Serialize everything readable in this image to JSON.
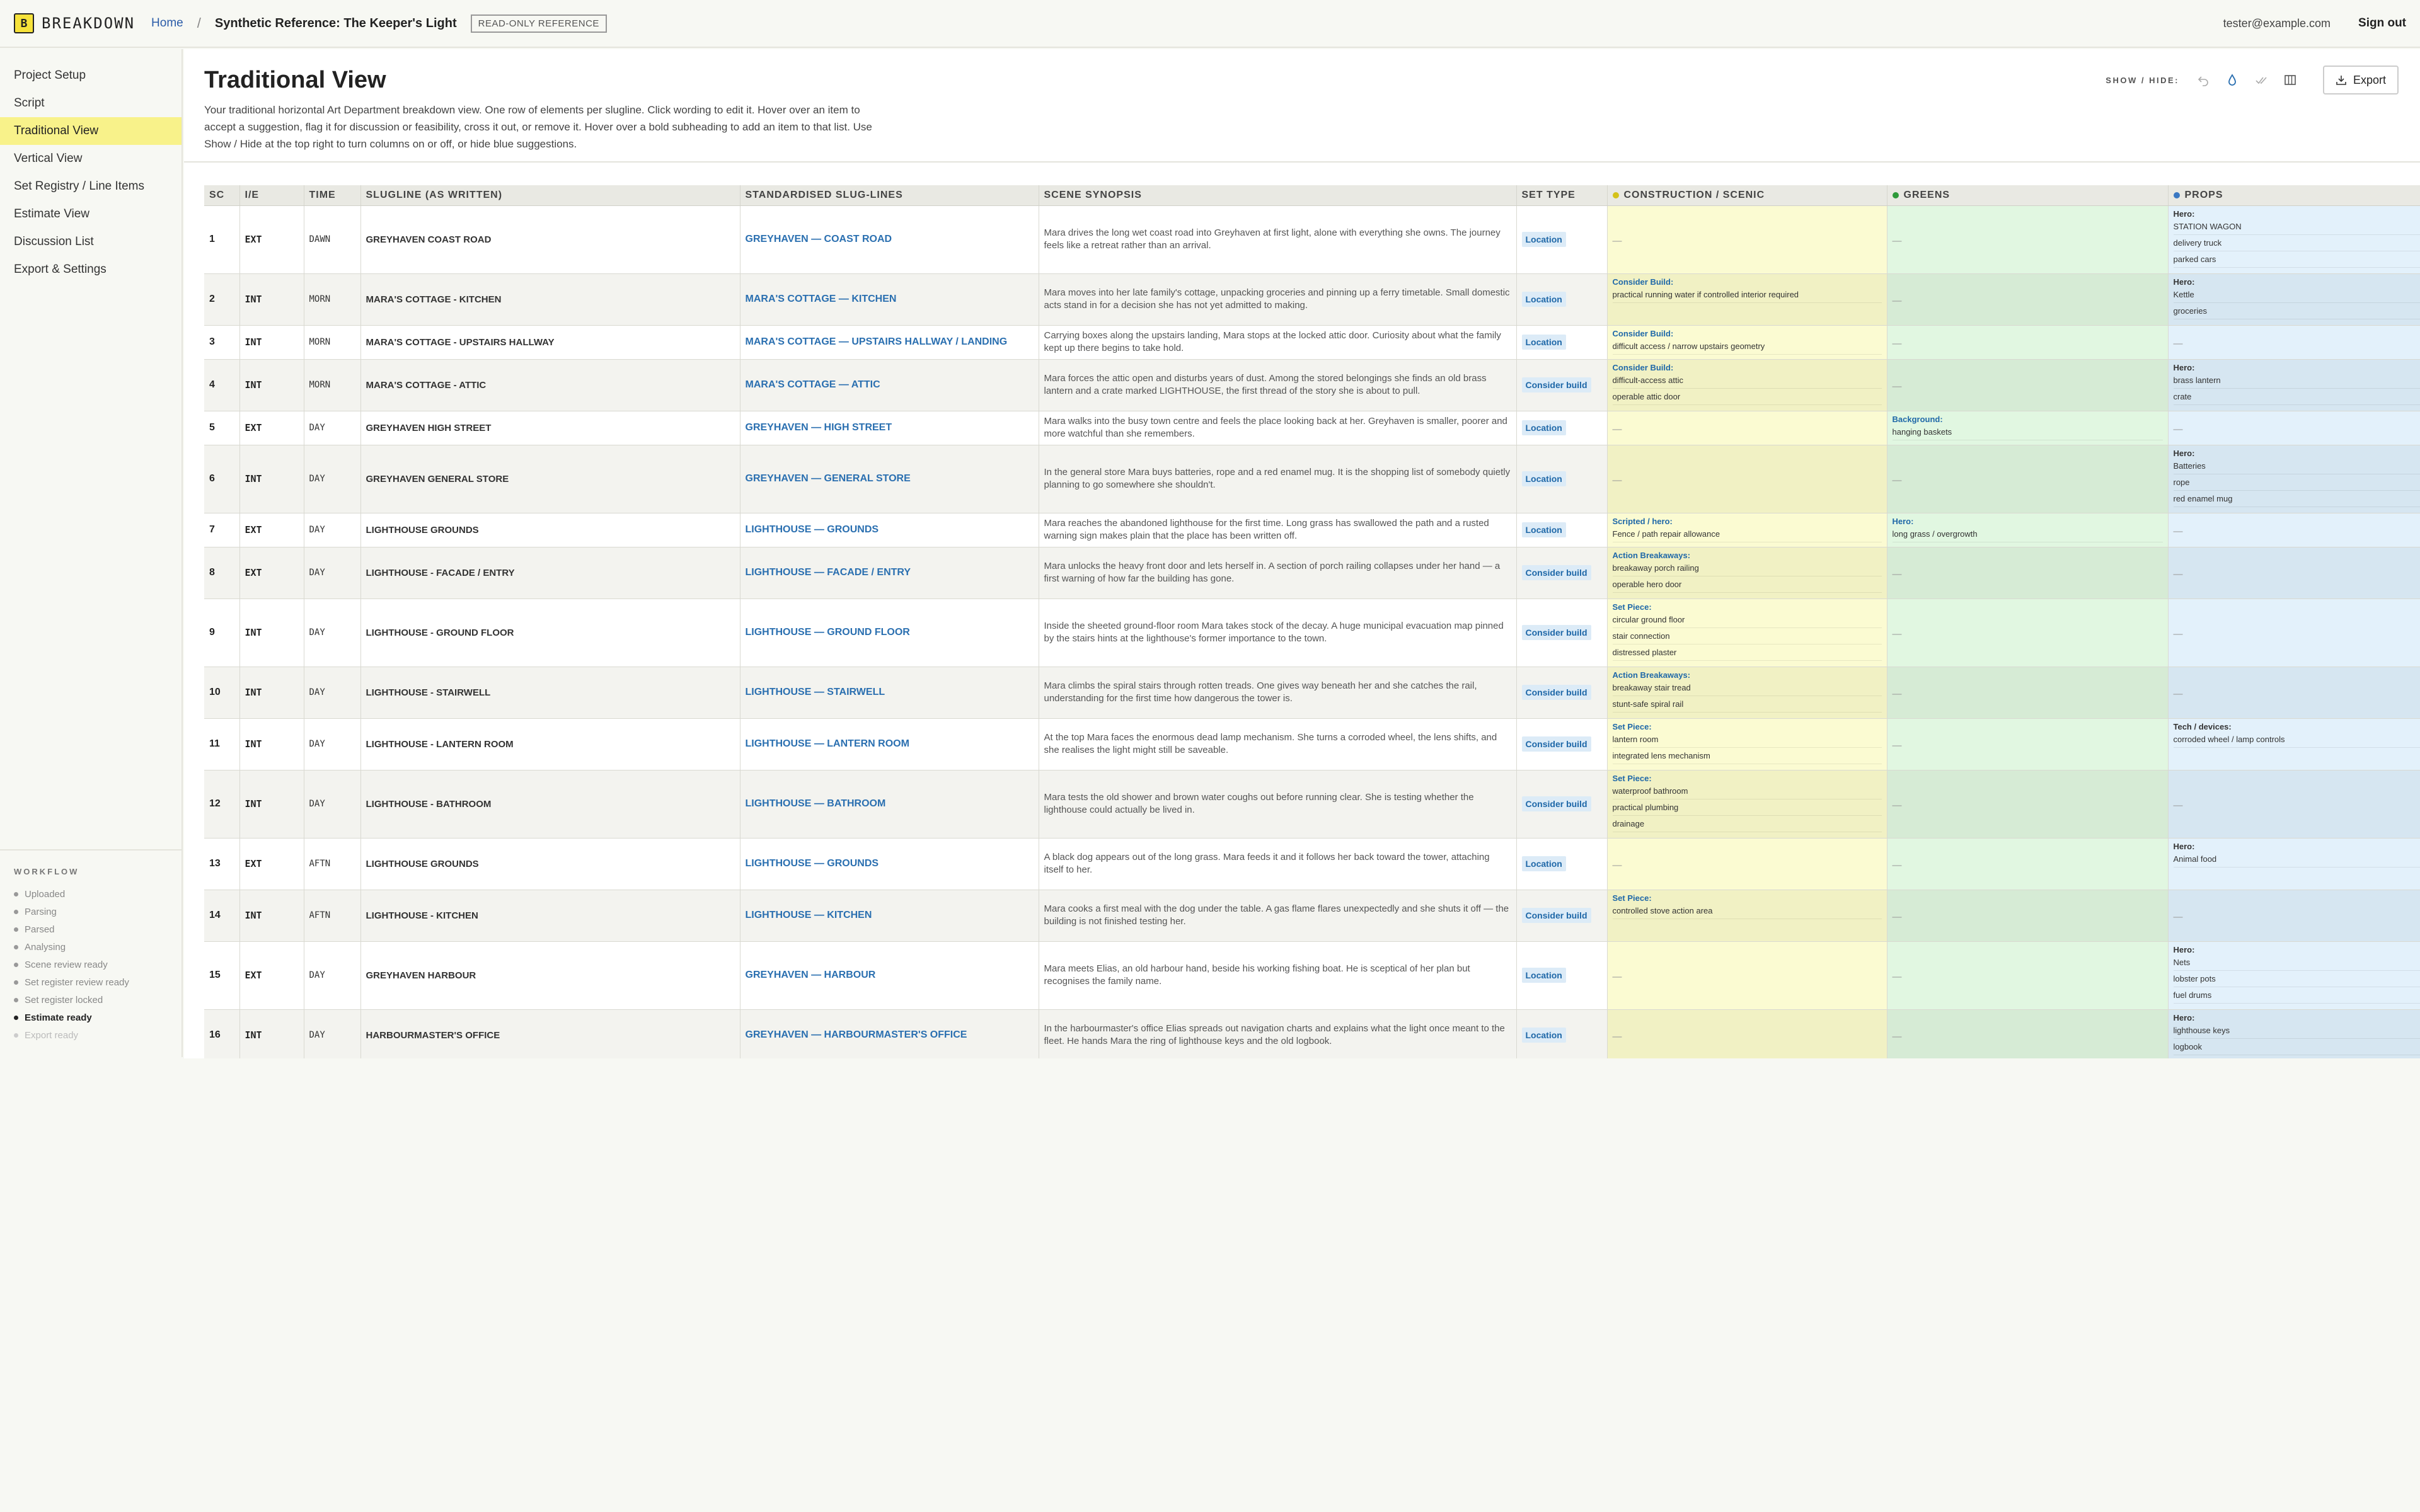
{
  "app": {
    "name": "BREAKDOWN",
    "logo_letter": "B"
  },
  "breadcrumb": {
    "home": "Home",
    "separator": "/",
    "title": "Synthetic Reference: The Keeper's Light",
    "badge": "READ-ONLY REFERENCE"
  },
  "user": {
    "email": "tester@example.com",
    "signout": "Sign out"
  },
  "nav": [
    {
      "label": "Project Setup",
      "active": false
    },
    {
      "label": "Script",
      "active": false
    },
    {
      "label": "Traditional View",
      "active": true
    },
    {
      "label": "Vertical View",
      "active": false
    },
    {
      "label": "Set Registry / Line Items",
      "active": false
    },
    {
      "label": "Estimate View",
      "active": false
    },
    {
      "label": "Discussion List",
      "active": false
    },
    {
      "label": "Export & Settings",
      "active": false
    }
  ],
  "workflow": {
    "title": "WORKFLOW",
    "steps": [
      {
        "label": "Uploaded",
        "state": "done"
      },
      {
        "label": "Parsing",
        "state": "done"
      },
      {
        "label": "Parsed",
        "state": "done"
      },
      {
        "label": "Analysing",
        "state": "done"
      },
      {
        "label": "Scene review ready",
        "state": "done"
      },
      {
        "label": "Set register review ready",
        "state": "done"
      },
      {
        "label": "Set register locked",
        "state": "done"
      },
      {
        "label": "Estimate ready",
        "state": "current"
      },
      {
        "label": "Export ready",
        "state": "future"
      }
    ]
  },
  "page": {
    "title": "Traditional View",
    "description": "Your traditional horizontal Art Department breakdown view. One row of elements per slugline. Click wording to edit it. Hover over an item to accept a suggestion, flag it for discussion or feasibility, cross it out, or remove it. Hover over a bold subheading to add an item to that list. Use Show / Hide at the top right to turn columns on or off, or hide blue suggestions."
  },
  "toolbar": {
    "show_hide": "SHOW / HIDE:",
    "export": "Export"
  },
  "colors": {
    "construction": "#d4c21a",
    "greens": "#2e9a3a",
    "props": "#3a78c2",
    "accent": "#f8f28a",
    "link": "#2a6fb0"
  },
  "columns": [
    "SC",
    "I/E",
    "TIME",
    "SLUGLINE (AS WRITTEN)",
    "STANDARDISED SLUG-LINES",
    "SCENE SYNOPSIS",
    "SET TYPE",
    "CONSTRUCTION / SCENIC",
    "GREENS",
    "PROPS"
  ],
  "empty_mark": "—",
  "rows": [
    {
      "sc": "1",
      "ie": "EXT",
      "time": "DAWN",
      "slug": "GREYHAVEN COAST ROAD",
      "std": "GREYHAVEN — COAST ROAD",
      "syn": "Mara drives the long wet coast road into Greyhaven at first light, alone with everything she owns. The journey feels like a retreat rather than an arrival.",
      "settype": "Location",
      "con": [],
      "grn": [],
      "prp": [
        {
          "head": "Hero:",
          "items": [
            "STATION WAGON",
            "delivery truck",
            "parked cars"
          ]
        }
      ]
    },
    {
      "sc": "2",
      "ie": "INT",
      "time": "MORN",
      "slug": "MARA'S COTTAGE - KITCHEN",
      "std": "MARA'S COTTAGE — KITCHEN",
      "syn": "Mara moves into her late family's cottage, unpacking groceries and pinning up a ferry timetable. Small domestic acts stand in for a decision she has not yet admitted to making.",
      "settype": "Location",
      "con": [
        {
          "head": "Consider Build:",
          "items": [
            "practical running water if controlled interior required"
          ]
        }
      ],
      "grn": [],
      "prp": [
        {
          "head": "Hero:",
          "items": [
            "Kettle",
            "groceries"
          ]
        }
      ]
    },
    {
      "sc": "3",
      "ie": "INT",
      "time": "MORN",
      "slug": "MARA'S COTTAGE - UPSTAIRS HALLWAY",
      "std": "MARA'S COTTAGE — UPSTAIRS HALLWAY / LANDING",
      "syn": "Carrying boxes along the upstairs landing, Mara stops at the locked attic door. Curiosity about what the family kept up there begins to take hold.",
      "settype": "Location",
      "con": [
        {
          "head": "Consider Build:",
          "items": [
            "difficult access / narrow upstairs geometry"
          ]
        }
      ],
      "grn": [],
      "prp": []
    },
    {
      "sc": "4",
      "ie": "INT",
      "time": "MORN",
      "slug": "MARA'S COTTAGE - ATTIC",
      "std": "MARA'S COTTAGE — ATTIC",
      "syn": "Mara forces the attic open and disturbs years of dust. Among the stored belongings she finds an old brass lantern and a crate marked LIGHTHOUSE, the first thread of the story she is about to pull.",
      "settype": "Consider build",
      "con": [
        {
          "head": "Consider Build:",
          "items": [
            "difficult-access attic",
            "operable attic door"
          ]
        }
      ],
      "grn": [],
      "prp": [
        {
          "head": "Hero:",
          "items": [
            "brass lantern",
            "crate"
          ]
        }
      ]
    },
    {
      "sc": "5",
      "ie": "EXT",
      "time": "DAY",
      "slug": "GREYHAVEN HIGH STREET",
      "std": "GREYHAVEN — HIGH STREET",
      "syn": "Mara walks into the busy town centre and feels the place looking back at her. Greyhaven is smaller, poorer and more watchful than she remembers.",
      "settype": "Location",
      "con": [],
      "grn": [
        {
          "head": "Background:",
          "items": [
            "hanging baskets"
          ]
        }
      ],
      "prp": []
    },
    {
      "sc": "6",
      "ie": "INT",
      "time": "DAY",
      "slug": "GREYHAVEN GENERAL STORE",
      "std": "GREYHAVEN — GENERAL STORE",
      "syn": "In the general store Mara buys batteries, rope and a red enamel mug. It is the shopping list of somebody quietly planning to go somewhere she shouldn't.",
      "settype": "Location",
      "con": [],
      "grn": [],
      "prp": [
        {
          "head": "Hero:",
          "items": [
            "Batteries",
            "rope",
            "red enamel mug"
          ]
        }
      ]
    },
    {
      "sc": "7",
      "ie": "EXT",
      "time": "DAY",
      "slug": "LIGHTHOUSE GROUNDS",
      "std": "LIGHTHOUSE — GROUNDS",
      "syn": "Mara reaches the abandoned lighthouse for the first time. Long grass has swallowed the path and a rusted warning sign makes plain that the place has been written off.",
      "settype": "Location",
      "con": [
        {
          "head": "Scripted / hero:",
          "items": [
            "Fence / path repair allowance"
          ]
        }
      ],
      "grn": [
        {
          "head": "Hero:",
          "items": [
            "long grass / overgrowth"
          ]
        }
      ],
      "prp": []
    },
    {
      "sc": "8",
      "ie": "EXT",
      "time": "DAY",
      "slug": "LIGHTHOUSE - FACADE / ENTRY",
      "std": "LIGHTHOUSE — FACADE / ENTRY",
      "syn": "Mara unlocks the heavy front door and lets herself in. A section of porch railing collapses under her hand — a first warning of how far the building has gone.",
      "settype": "Consider build",
      "con": [
        {
          "head": "Action Breakaways:",
          "items": [
            "breakaway porch railing",
            "operable hero door"
          ]
        }
      ],
      "grn": [],
      "prp": []
    },
    {
      "sc": "9",
      "ie": "INT",
      "time": "DAY",
      "slug": "LIGHTHOUSE - GROUND FLOOR",
      "std": "LIGHTHOUSE — GROUND FLOOR",
      "syn": "Inside the sheeted ground-floor room Mara takes stock of the decay. A huge municipal evacuation map pinned by the stairs hints at the lighthouse's former importance to the town.",
      "settype": "Consider build",
      "con": [
        {
          "head": "Set Piece:",
          "items": [
            "circular ground floor",
            "stair connection",
            "distressed plaster"
          ]
        }
      ],
      "grn": [],
      "prp": []
    },
    {
      "sc": "10",
      "ie": "INT",
      "time": "DAY",
      "slug": "LIGHTHOUSE - STAIRWELL",
      "std": "LIGHTHOUSE — STAIRWELL",
      "syn": "Mara climbs the spiral stairs through rotten treads. One gives way beneath her and she catches the rail, understanding for the first time how dangerous the tower is.",
      "settype": "Consider build",
      "con": [
        {
          "head": "Action Breakaways:",
          "items": [
            "breakaway stair tread",
            "stunt-safe spiral rail"
          ]
        }
      ],
      "grn": [],
      "prp": []
    },
    {
      "sc": "11",
      "ie": "INT",
      "time": "DAY",
      "slug": "LIGHTHOUSE - LANTERN ROOM",
      "std": "LIGHTHOUSE — LANTERN ROOM",
      "syn": "At the top Mara faces the enormous dead lamp mechanism. She turns a corroded wheel, the lens shifts, and she realises the light might still be saveable.",
      "settype": "Consider build",
      "con": [
        {
          "head": "Set Piece:",
          "items": [
            "lantern room",
            "integrated lens mechanism"
          ]
        }
      ],
      "grn": [],
      "prp": [
        {
          "head": "Tech / devices:",
          "items": [
            "corroded wheel / lamp controls"
          ]
        }
      ]
    },
    {
      "sc": "12",
      "ie": "INT",
      "time": "DAY",
      "slug": "LIGHTHOUSE - BATHROOM",
      "std": "LIGHTHOUSE — BATHROOM",
      "syn": "Mara tests the old shower and brown water coughs out before running clear. She is testing whether the lighthouse could actually be lived in.",
      "settype": "Consider build",
      "con": [
        {
          "head": "Set Piece:",
          "items": [
            "waterproof bathroom",
            "practical plumbing",
            "drainage"
          ]
        }
      ],
      "grn": [],
      "prp": []
    },
    {
      "sc": "13",
      "ie": "EXT",
      "time": "AFTN",
      "slug": "LIGHTHOUSE GROUNDS",
      "std": "LIGHTHOUSE — GROUNDS",
      "syn": "A black dog appears out of the long grass. Mara feeds it and it follows her back toward the tower, attaching itself to her.",
      "settype": "Location",
      "con": [],
      "grn": [],
      "prp": [
        {
          "head": "Hero:",
          "items": [
            "Animal food"
          ]
        }
      ]
    },
    {
      "sc": "14",
      "ie": "INT",
      "time": "AFTN",
      "slug": "LIGHTHOUSE - KITCHEN",
      "std": "LIGHTHOUSE — KITCHEN",
      "syn": "Mara cooks a first meal with the dog under the table. A gas flame flares unexpectedly and she shuts it off — the building is not finished testing her.",
      "settype": "Consider build",
      "con": [
        {
          "head": "Set Piece:",
          "items": [
            "controlled stove action area"
          ]
        }
      ],
      "grn": [],
      "prp": []
    },
    {
      "sc": "15",
      "ie": "EXT",
      "time": "DAY",
      "slug": "GREYHAVEN HARBOUR",
      "std": "GREYHAVEN — HARBOUR",
      "syn": "Mara meets Elias, an old harbour hand, beside his working fishing boat. He is sceptical of her plan but recognises the family name.",
      "settype": "Location",
      "con": [],
      "grn": [],
      "prp": [
        {
          "head": "Hero:",
          "items": [
            "Nets",
            "lobster pots",
            "fuel drums"
          ]
        }
      ]
    },
    {
      "sc": "16",
      "ie": "INT",
      "time": "DAY",
      "slug": "HARBOURMASTER'S OFFICE",
      "std": "GREYHAVEN — HARBOURMASTER'S OFFICE",
      "syn": "In the harbourmaster's office Elias spreads out navigation charts and explains what the light once meant to the fleet. He hands Mara the ring of lighthouse keys and the old logbook.",
      "settype": "Location",
      "con": [],
      "grn": [],
      "prp": [
        {
          "head": "Hero:",
          "items": [
            "lighthouse keys",
            "logbook"
          ]
        }
      ]
    }
  ]
}
